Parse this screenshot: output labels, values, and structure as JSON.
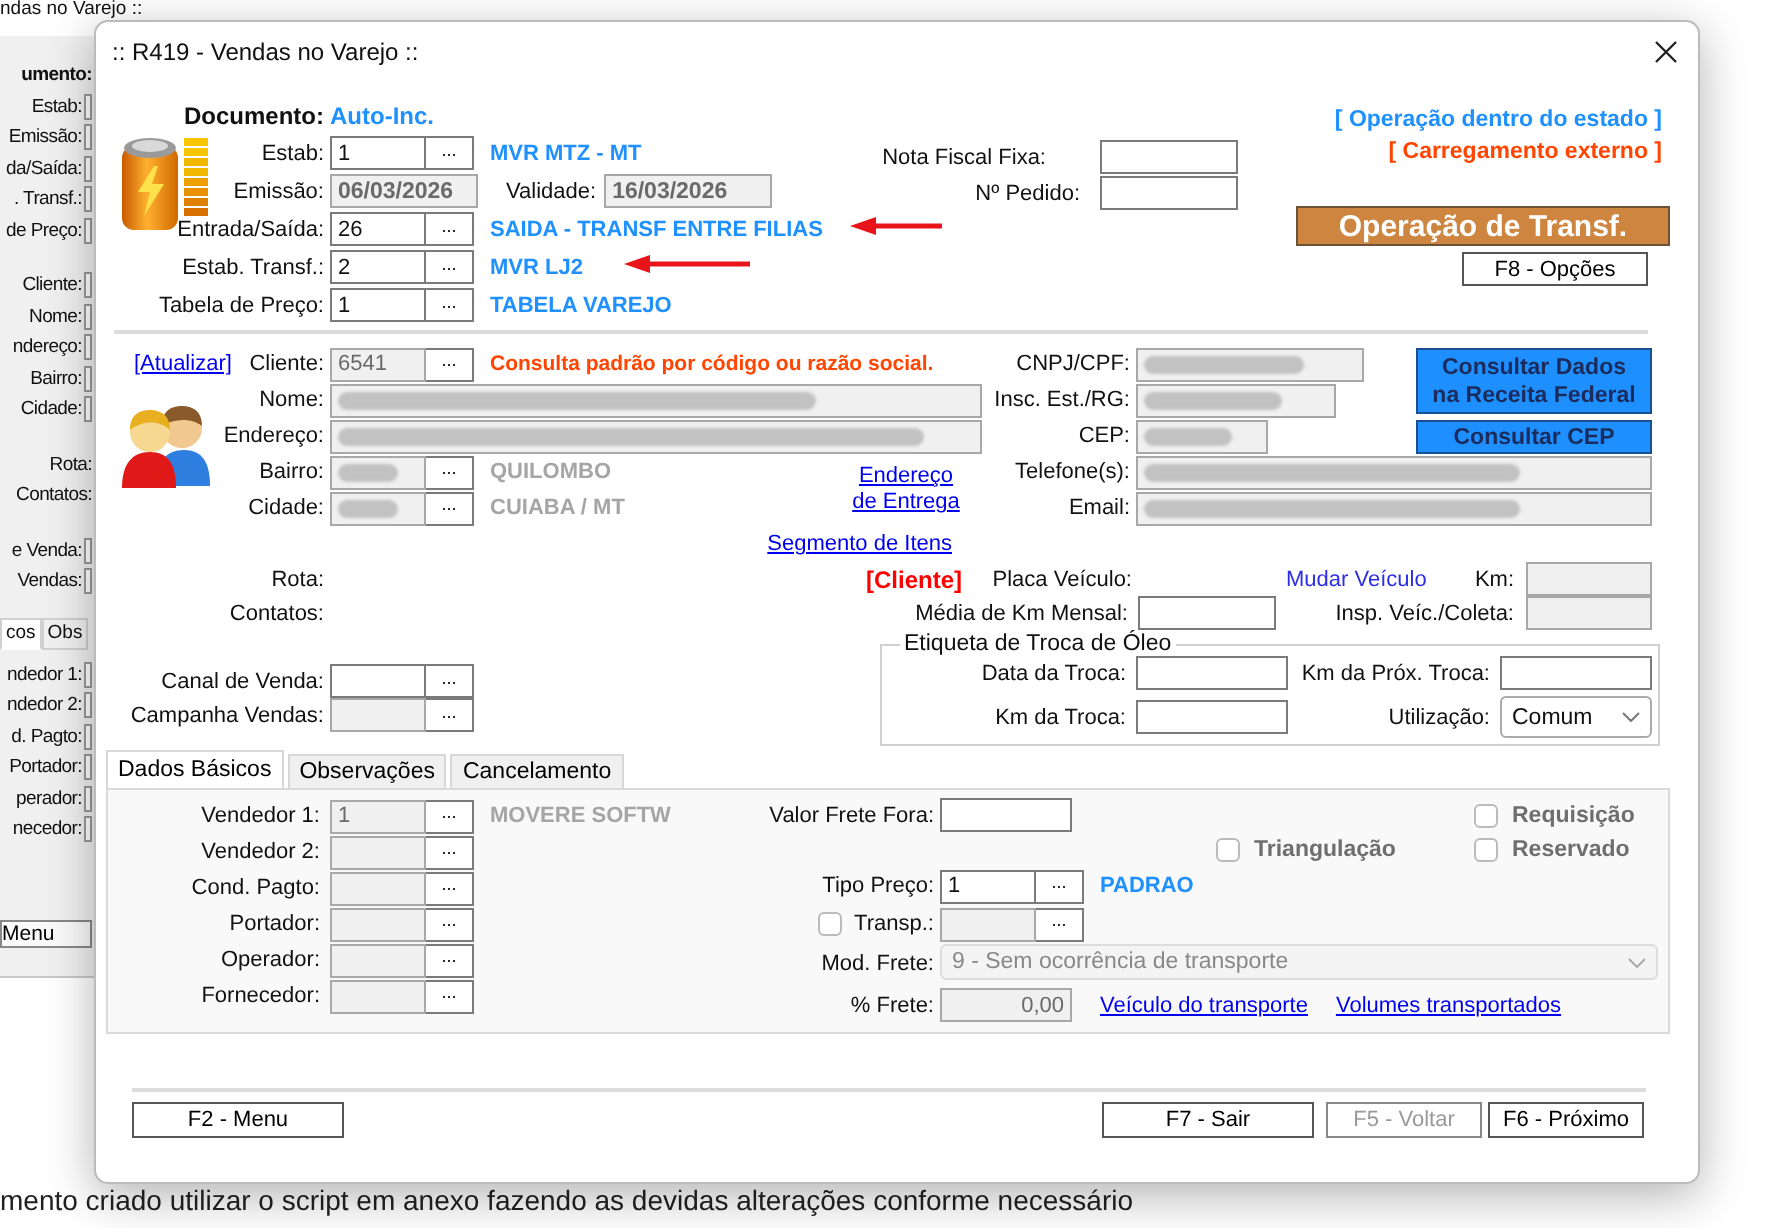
{
  "background_window": {
    "title": "ndas no Varejo ::",
    "sections": [
      {
        "kind": "rows",
        "rows": [
          {
            "kind": "heading",
            "label": "umento:"
          },
          {
            "kind": "field",
            "label": "Estab:"
          },
          {
            "kind": "field",
            "label": "Emissão:"
          },
          {
            "kind": "field",
            "label": "da/Saída:"
          },
          {
            "kind": "field",
            "label": ". Transf.:"
          },
          {
            "kind": "field",
            "label": "de Preço:"
          }
        ]
      },
      {
        "kind": "rows",
        "rows": [
          {
            "kind": "field",
            "label": "Cliente:"
          },
          {
            "kind": "field",
            "label": "Nome:"
          },
          {
            "kind": "field",
            "label": "ndereço:"
          },
          {
            "kind": "field",
            "label": "Bairro:"
          },
          {
            "kind": "field",
            "label": "Cidade:"
          }
        ]
      },
      {
        "kind": "rows",
        "rows": [
          {
            "kind": "text",
            "label": "Rota:"
          },
          {
            "kind": "text",
            "label": "Contatos:"
          }
        ]
      },
      {
        "kind": "rows",
        "rows": [
          {
            "kind": "field",
            "label": "e Venda:"
          },
          {
            "kind": "field",
            "label": "Vendas:"
          }
        ]
      },
      {
        "kind": "tabs",
        "tabs": [
          {
            "label": "cos",
            "selected": true
          },
          {
            "label": "Obs",
            "selected": false
          }
        ]
      },
      {
        "kind": "rows",
        "rows": [
          {
            "kind": "field",
            "label": "ndedor 1:"
          },
          {
            "kind": "field",
            "label": "ndedor 2:"
          },
          {
            "kind": "field",
            "label": "d. Pagto:"
          },
          {
            "kind": "field",
            "label": "Portador:"
          },
          {
            "kind": "field",
            "label": "perador:"
          },
          {
            "kind": "field",
            "label": "necedor:"
          }
        ]
      },
      {
        "kind": "button",
        "label": "Menu"
      }
    ]
  },
  "page_text": "mento criado utilizar o script em anexo fazendo as devidas alterações conforme necessário",
  "dialog": {
    "title": ":: R419 - Vendas no Varejo ::",
    "header": {
      "rows": [
        {
          "kind": "document",
          "label": "Documento:",
          "value": "Auto-Inc."
        },
        {
          "kind": "lookup",
          "label": "Estab:",
          "value": "1",
          "button": "...",
          "disabled": false,
          "description": "MVR MTZ - MT"
        },
        {
          "kind": "dates",
          "label": "Emissão:",
          "value": "06/03/2026",
          "disabled": true,
          "second_label": "Validade:",
          "second_value": "16/03/2026"
        },
        {
          "kind": "lookup",
          "label": "Entrada/Saída:",
          "value": "26",
          "button": "...",
          "disabled": false,
          "description": "SAIDA - TRANSF ENTRE FILIAS"
        },
        {
          "kind": "lookup",
          "label": "Estab. Transf.:",
          "value": "2",
          "button": "...",
          "disabled": false,
          "description": "MVR LJ2"
        },
        {
          "kind": "lookup",
          "label": "Tabela de Preço:",
          "value": "1",
          "button": "...",
          "disabled": false,
          "description": "TABELA VAREJO"
        }
      ],
      "fiscal_note": {
        "label": "Nota Fiscal Fixa:"
      },
      "order": {
        "label": "Nº Pedido:"
      },
      "status": [
        {
          "text": "[ Operação dentro do estado ]",
          "color": "#1e90ff"
        },
        {
          "text": "[ Carregamento externo ]",
          "color": "#ff4500"
        }
      ],
      "banner": "Operação de Transf.",
      "options_button": "F8 - Opções"
    },
    "client": {
      "refresh_link": "[Atualizar]",
      "cliente": {
        "label": "Cliente:",
        "value": "6541",
        "button": "...",
        "disabled": true,
        "hint": "Consulta padrão por código ou razão social."
      },
      "nome": {
        "label": "Nome:",
        "redacted": true,
        "disabled": true
      },
      "endereco": {
        "label": "Endereço:",
        "redacted": true,
        "disabled": true
      },
      "bairro": {
        "label": "Bairro:",
        "redacted": true,
        "disabled": true,
        "button": "...",
        "description": "QUILOMBO"
      },
      "cidade": {
        "label": "Cidade:",
        "redacted": true,
        "disabled": true,
        "button": "...",
        "description": "CUIABA / MT"
      },
      "delivery_link": "Endereço de Entrega",
      "segment_link": "Segmento de Itens",
      "ids": [
        {
          "label": "CNPJ/CPF:",
          "redacted": true,
          "disabled": true
        },
        {
          "label": "Insc. Est./RG:",
          "redacted": true,
          "disabled": true
        },
        {
          "label": "CEP:",
          "redacted": true,
          "disabled": true
        },
        {
          "label": "Telefone(s):",
          "redacted": true,
          "disabled": true
        },
        {
          "label": "Email:",
          "redacted": true,
          "disabled": true
        }
      ],
      "buttons": [
        "Consultar Dados na Receita Federal",
        "Consultar CEP"
      ]
    },
    "vehicle": {
      "rota": "Rota:",
      "contatos": "Contatos:",
      "canal": {
        "label": "Canal de Venda:",
        "button": "...",
        "disabled": false
      },
      "campanha": {
        "label": "Campanha Vendas:",
        "button": "...",
        "disabled": true
      },
      "client_tag": "[Cliente]",
      "plate_label": "Placa Veículo:",
      "change_link": "Mudar Veículo",
      "km": {
        "label": "Km:",
        "disabled": true
      },
      "monthly_km": {
        "label": "Média de Km Mensal:",
        "disabled": false
      },
      "inspection": {
        "label": "Insp. Veíc./Coleta:",
        "disabled": true
      },
      "oil": {
        "title": "Etiqueta de Troca de Óleo",
        "change_date": {
          "label": "Data da Troca:"
        },
        "next_km": {
          "label": "Km da Próx. Troca:"
        },
        "change_km": {
          "label": "Km da Troca:"
        },
        "usage": {
          "label": "Utilização:",
          "value": "Comum"
        }
      }
    },
    "tabs": [
      {
        "label": "Dados Básicos",
        "selected": true
      },
      {
        "label": "Observações",
        "selected": false
      },
      {
        "label": "Cancelamento",
        "selected": false
      }
    ],
    "basic_data": {
      "sellers": [
        {
          "label": "Vendedor 1:",
          "value": "1",
          "button": "...",
          "disabled": true,
          "description": "MOVERE SOFTW"
        },
        {
          "label": "Vendedor 2:",
          "button": "...",
          "disabled": true
        },
        {
          "label": "Cond. Pagto:",
          "button": "...",
          "disabled": true
        },
        {
          "label": "Portador:",
          "button": "...",
          "disabled": true
        },
        {
          "label": "Operador:",
          "button": "...",
          "disabled": true
        },
        {
          "label": "Fornecedor:",
          "button": "...",
          "disabled": true
        }
      ],
      "freight_outside": {
        "label": "Valor Frete Fora:"
      },
      "flags": [
        {
          "label": "Requisição",
          "checked": false,
          "disabled": true
        },
        {
          "label": "Triangulação",
          "checked": false,
          "disabled": true
        },
        {
          "label": "Reservado",
          "checked": false,
          "disabled": true
        }
      ],
      "price_type": {
        "label": "Tipo Preço:",
        "value": "1",
        "button": "...",
        "disabled": false,
        "description": "PADRAO"
      },
      "carrier": {
        "label": "Transp.:",
        "checked": false,
        "button": "...",
        "disabled": true
      },
      "freight_mode": {
        "label": "Mod. Frete:",
        "value": "9 - Sem ocorrência de transporte",
        "disabled": true
      },
      "freight_percent": {
        "label": "% Frete:",
        "value": "0,00",
        "disabled": true
      },
      "links": [
        "Veículo do transporte",
        "Volumes transportados"
      ]
    },
    "footer_buttons": [
      {
        "label": "F2 - Menu",
        "disabled": false
      },
      {
        "label": "F7 - Sair",
        "disabled": false
      },
      {
        "label": "F5 - Voltar",
        "disabled": true
      },
      {
        "label": "F6 - Próximo",
        "disabled": false
      }
    ]
  }
}
